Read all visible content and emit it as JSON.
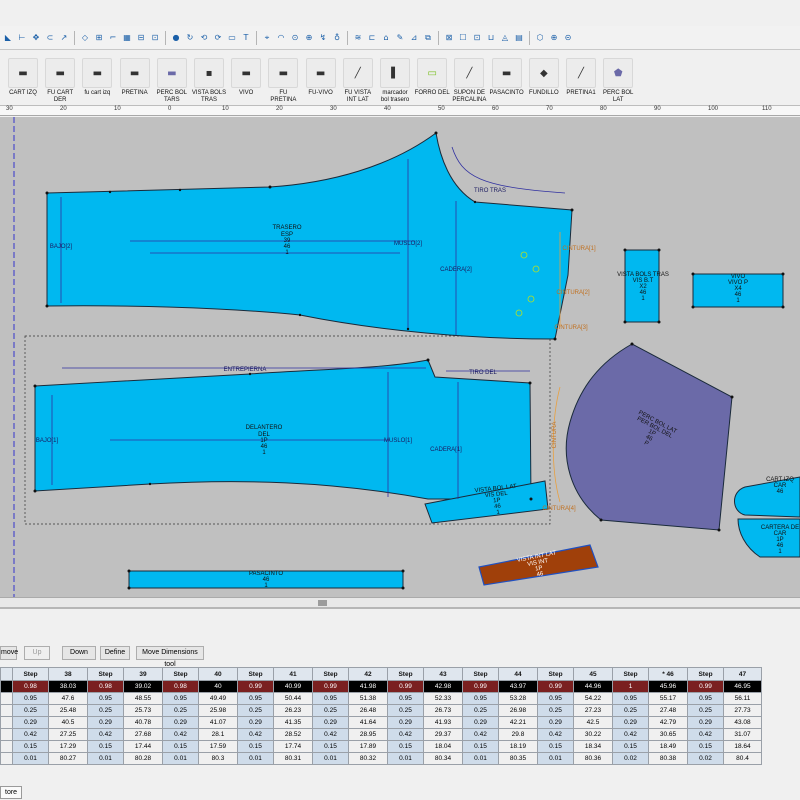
{
  "palette": [
    {
      "label": "CART IZQ"
    },
    {
      "label": "FU CART\nDER"
    },
    {
      "label": "fu cart izq"
    },
    {
      "label": "PRETINA"
    },
    {
      "label": "PERC BOL\nTARS"
    },
    {
      "label": "VISTA BOLS\nTRAS"
    },
    {
      "label": "VIVO"
    },
    {
      "label": "FU\nPRETINA"
    },
    {
      "label": "FU-VIVO"
    },
    {
      "label": "FU VISTA\nINT LAT"
    },
    {
      "label": "marcador\nbol trasero"
    },
    {
      "label": "FORRO DEL"
    },
    {
      "label": "SUPON DE\nPERCALINA"
    },
    {
      "label": "PASACINTO"
    },
    {
      "label": "FUNDILLO"
    },
    {
      "label": "PRETINA1"
    },
    {
      "label": "PERC BOL\nLAT"
    }
  ],
  "ruler": [
    "30",
    "20",
    "10",
    "0",
    "10",
    "20",
    "30",
    "40",
    "50",
    "60",
    "70",
    "80",
    "90",
    "100",
    "110"
  ],
  "pieces": {
    "trasero": {
      "name": "TRASERO",
      "lines": [
        "ESP",
        "39",
        "46",
        "1"
      ]
    },
    "delantero": {
      "name": "DELANTERO",
      "lines": [
        "DEL",
        "1P",
        "46",
        "1"
      ]
    },
    "vista_bols_tras": {
      "name": "VISTA BOLS TRAS",
      "lines": [
        "VIS B.T",
        "X2",
        "46",
        "1"
      ]
    },
    "vivo": {
      "name": "VIVO",
      "lines": [
        "VIVO P",
        "X4",
        "46",
        "1"
      ]
    },
    "perc_bol_lat": {
      "name": "PERC BOL LAT",
      "lines": [
        "PER BOL DEL",
        "1P",
        "46",
        "P"
      ]
    },
    "cart_izq": {
      "name": "CART IZQ",
      "lines": [
        "CAR",
        "46"
      ]
    },
    "cartera": {
      "name": "CARTERA DE",
      "lines": [
        "CAR",
        "1P",
        "46",
        "1"
      ]
    },
    "vista_bol_lat": {
      "name": "VISTA BOL LAT",
      "lines": [
        "VIS DEL",
        "1P",
        "46",
        "1"
      ]
    },
    "pasacinto": {
      "name": "PASACINTO",
      "lines": [
        "46",
        "1"
      ]
    },
    "vista_int": {
      "name": "VISTA INT LAT",
      "lines": [
        "VIS INT",
        "1P",
        "46"
      ]
    }
  },
  "dimensions": {
    "bajo2": "BAJO[2]",
    "muslo2": "MUSLO[2]",
    "cadera2": "CADERA[2]",
    "tiro_tras": "TIRO TRAS",
    "bajo1": "BAJO[1]",
    "muslo1": "MUSLO[1]",
    "cadera1": "CADERA[1]",
    "entrepierna": "ENTREPIERNA",
    "tiro_del": "TIRO DEL",
    "cintura": "CINTURA",
    "cintura_tras": [
      "CINTURA[1]",
      "CINTURA[2]",
      "CINTURA[3]",
      "CINTURA[4]"
    ]
  },
  "buttons": {
    "remove": "move",
    "up": "Up",
    "down": "Down",
    "define": "Define",
    "move_dims": "Move Dimensions tool"
  },
  "table": {
    "headers": [
      "",
      "Step",
      "38",
      "Step",
      "39",
      "Step",
      "40",
      "Step",
      "41",
      "Step",
      "42",
      "Step",
      "43",
      "Step",
      "44",
      "Step",
      "45",
      "Step",
      "* 46",
      "Step",
      "47"
    ],
    "rows": [
      [
        "",
        "0.98",
        "38.03",
        "0.98",
        "39.02",
        "0.98",
        "40",
        "0.99",
        "40.99",
        "0.99",
        "41.98",
        "0.99",
        "42.98",
        "0.99",
        "43.97",
        "0.99",
        "44.96",
        "1",
        "45.96",
        "0.99",
        "46.95"
      ],
      [
        "",
        "0.95",
        "47.6",
        "0.95",
        "48.55",
        "0.95",
        "49.49",
        "0.95",
        "50.44",
        "0.95",
        "51.38",
        "0.95",
        "52.33",
        "0.95",
        "53.28",
        "0.95",
        "54.22",
        "0.95",
        "55.17",
        "0.95",
        "56.11"
      ],
      [
        "",
        "0.25",
        "25.48",
        "0.25",
        "25.73",
        "0.25",
        "25.98",
        "0.25",
        "26.23",
        "0.25",
        "26.48",
        "0.25",
        "26.73",
        "0.25",
        "26.98",
        "0.25",
        "27.23",
        "0.25",
        "27.48",
        "0.25",
        "27.73"
      ],
      [
        "",
        "0.29",
        "40.5",
        "0.29",
        "40.78",
        "0.29",
        "41.07",
        "0.29",
        "41.35",
        "0.29",
        "41.64",
        "0.29",
        "41.93",
        "0.29",
        "42.21",
        "0.29",
        "42.5",
        "0.29",
        "42.79",
        "0.29",
        "43.08"
      ],
      [
        "",
        "0.42",
        "27.25",
        "0.42",
        "27.68",
        "0.42",
        "28.1",
        "0.42",
        "28.52",
        "0.42",
        "28.95",
        "0.42",
        "29.37",
        "0.42",
        "29.8",
        "0.42",
        "30.22",
        "0.42",
        "30.65",
        "0.42",
        "31.07"
      ],
      [
        "",
        "0.15",
        "17.29",
        "0.15",
        "17.44",
        "0.15",
        "17.59",
        "0.15",
        "17.74",
        "0.15",
        "17.89",
        "0.15",
        "18.04",
        "0.15",
        "18.19",
        "0.15",
        "18.34",
        "0.15",
        "18.49",
        "0.15",
        "18.64"
      ],
      [
        "",
        "0.01",
        "80.27",
        "0.01",
        "80.28",
        "0.01",
        "80.3",
        "0.01",
        "80.31",
        "0.01",
        "80.32",
        "0.01",
        "80.34",
        "0.01",
        "80.35",
        "0.01",
        "80.36",
        "0.02",
        "80.38",
        "0.02",
        "80.4"
      ]
    ]
  },
  "status_tab": "tore",
  "colors": {
    "piece": "#00b8f0",
    "perc": "#6b6aa8",
    "brown": "#a0400a",
    "canvas": "#c0c0c0",
    "dim": "#3030a0",
    "dim_orange": "#e8a040"
  }
}
